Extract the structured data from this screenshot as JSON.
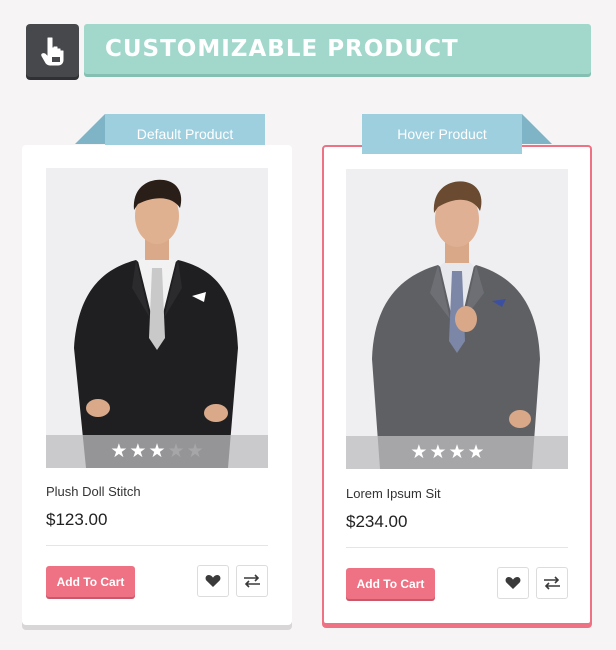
{
  "header": {
    "title": "CUSTOMIZABLE PRODUCT",
    "badge_icon": "hand-pointer-icon"
  },
  "colors": {
    "title_bar": "#a1d8cb",
    "badge": "#47484c",
    "ribbon": "#9dcfde",
    "accent": "#ee7283"
  },
  "cards": [
    {
      "ribbon": "Default Product",
      "name": "Plush Doll Stitch",
      "price": "$123.00",
      "rating": 3,
      "rating_max": 5,
      "cart_label": "Add To Cart",
      "wishlist_icon": "heart-icon",
      "compare_icon": "compare-arrows-icon"
    },
    {
      "ribbon": "Hover Product",
      "name": "Lorem Ipsum Sit",
      "price": "$234.00",
      "rating": 4,
      "rating_max": 5,
      "cart_label": "Add To Cart",
      "wishlist_icon": "heart-icon",
      "compare_icon": "compare-arrows-icon"
    }
  ]
}
